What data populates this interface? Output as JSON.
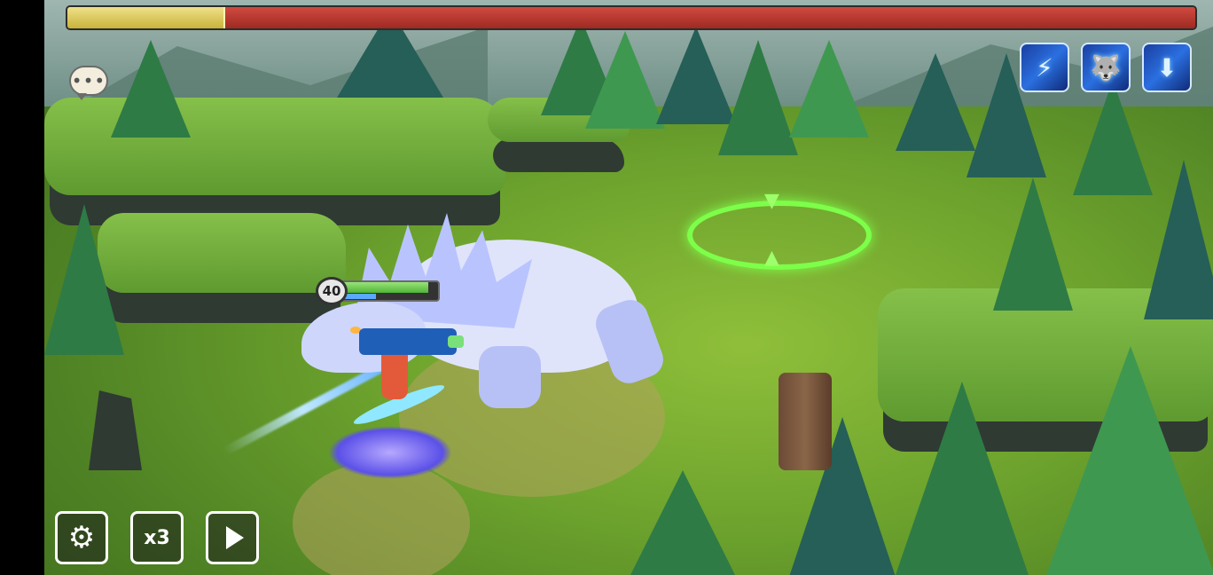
{
  "boss_hp": {
    "remaining_fraction": 0.14,
    "colors": {
      "remaining": "#dccb5a",
      "lost": "#b8352c"
    }
  },
  "chat": {
    "icon": "chat-bubble-icon",
    "glyph": "•••"
  },
  "skills": [
    {
      "icon": "claw-slash-skill-icon",
      "glyph": "⚡"
    },
    {
      "icon": "wolf-howl-skill-icon",
      "glyph": "🐺"
    },
    {
      "icon": "down-arrow-skill-icon",
      "glyph": "⬇"
    }
  ],
  "monster": {
    "level": "40",
    "hp_fraction": 0.9,
    "attack_bar_fraction": 0.35
  },
  "controls": {
    "settings_icon": "gear-icon",
    "settings_glyph": "⚙",
    "speed_label": "x3",
    "play_icon": "play-icon"
  }
}
